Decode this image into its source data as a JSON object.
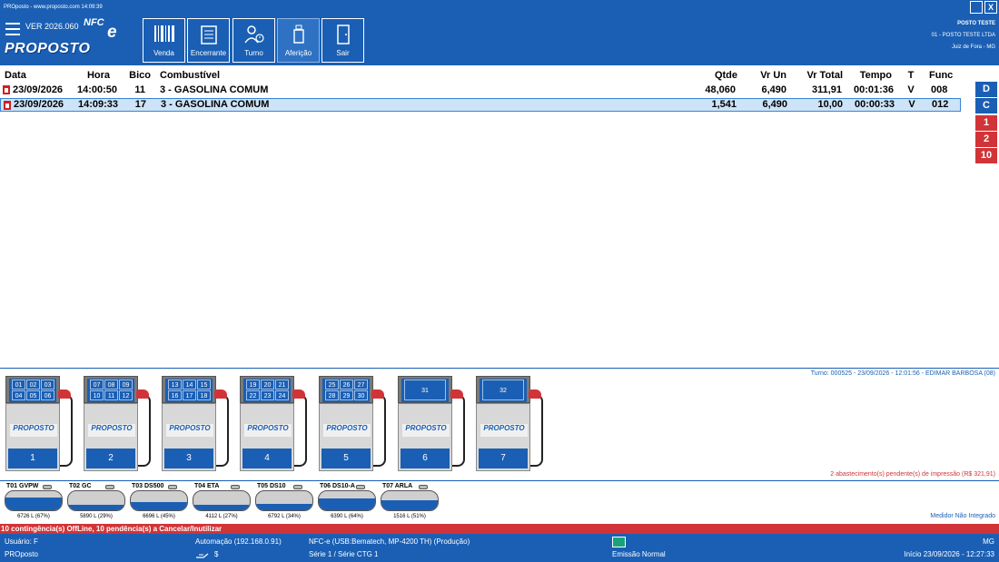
{
  "titlebar": {
    "text": "PROposto - www.proposto.com 14:09:39",
    "minimize_label": "",
    "close_label": "X"
  },
  "header": {
    "version": "VER 2026.060",
    "nfce_text": "NFC",
    "nfce_e": "e",
    "brand_text": "PROPOSTO",
    "buttons": [
      {
        "label": "Venda",
        "icon": "barcode-icon"
      },
      {
        "label": "Encerrante",
        "icon": "clipboard-icon"
      },
      {
        "label": "Turno",
        "icon": "person-clock-icon"
      },
      {
        "label": "Aferição",
        "icon": "flask-icon"
      },
      {
        "label": "Sair",
        "icon": "door-icon"
      }
    ],
    "posto": {
      "name": "POSTO TESTE",
      "company": "01 - POSTO TESTE LTDA",
      "city": "Juiz de Fora - MG"
    }
  },
  "grid": {
    "columns": [
      "Data",
      "Hora",
      "Bico",
      "Combustível",
      "Qtde",
      "Vr Un",
      "Vr Total",
      "Tempo",
      "T",
      "Func"
    ],
    "rows": [
      {
        "data": "23/09/2026",
        "hora": "14:00:50",
        "bico": "11",
        "combustivel": "3 - GASOLINA COMUM",
        "qtde": "48,060",
        "vrun": "6,490",
        "vrtotal": "311,91",
        "tempo": "00:01:36",
        "t": "V",
        "func": "008"
      },
      {
        "data": "23/09/2026",
        "hora": "14:09:33",
        "bico": "17",
        "combustivel": "3 - GASOLINA COMUM",
        "qtde": "1,541",
        "vrun": "6,490",
        "vrtotal": "10,00",
        "tempo": "00:00:33",
        "t": "V",
        "func": "012"
      }
    ],
    "side_buttons": [
      {
        "label": "D",
        "color": "blue"
      },
      {
        "label": "C",
        "color": "blue"
      },
      {
        "label": "1",
        "color": "red"
      },
      {
        "label": "2",
        "color": "red"
      },
      {
        "label": "10",
        "color": "red"
      }
    ]
  },
  "turno_info": "Turno: 000525 - 23/09/2026 - 12:01:56 - EDIMAR BARBOSA (08)",
  "pumps": [
    {
      "number": "1",
      "nozzles": [
        "01",
        "02",
        "03",
        "04",
        "05",
        "06"
      ]
    },
    {
      "number": "2",
      "nozzles": [
        "07",
        "08",
        "09",
        "10",
        "11",
        "12"
      ]
    },
    {
      "number": "3",
      "nozzles": [
        "13",
        "14",
        "15",
        "16",
        "17",
        "18"
      ]
    },
    {
      "number": "4",
      "nozzles": [
        "19",
        "20",
        "21",
        "22",
        "23",
        "24"
      ]
    },
    {
      "number": "5",
      "nozzles": [
        "25",
        "26",
        "27",
        "28",
        "29",
        "30"
      ]
    },
    {
      "number": "6",
      "nozzles": [
        "31"
      ]
    },
    {
      "number": "7",
      "nozzles": [
        "32"
      ]
    }
  ],
  "pump_logo": "PROPOSTO",
  "pending_info": "2 abastecimento(s) pendente(s) de impressão (R$ 321,91)",
  "tanks": [
    {
      "label": "T01 GVPW",
      "volume": "6726 L (67%)",
      "fill": 0.67
    },
    {
      "label": "T02 GC",
      "volume": "5890 L (29%)",
      "fill": 0.29
    },
    {
      "label": "T03 DS500",
      "volume": "6696 L (45%)",
      "fill": 0.45
    },
    {
      "label": "T04 ETA",
      "volume": "4112 L (27%)",
      "fill": 0.27
    },
    {
      "label": "T05 DS10",
      "volume": "6792 L (34%)",
      "fill": 0.34
    },
    {
      "label": "T06 DS10-A",
      "volume": "6390 L (64%)",
      "fill": 0.64
    },
    {
      "label": "T07 ARLA",
      "volume": "1516 L (51%)",
      "fill": 0.51
    }
  ],
  "medidor_info": "Medidor Não Integrado",
  "contingency": "10 contingência(s) OffLine, 10 pendência(s) a Cancelar/Inutilizar",
  "statusbar": {
    "usuario": "Usuário: F",
    "app": "PROposto",
    "automacao": "Automação (192.168.0.91)",
    "money_symbol": "$",
    "nfce": "NFC-e (USB:Bematech, MP-4200 TH) (Produção)",
    "serie": "Série    1  /   Série CTG     1",
    "emissao": "Emissão Normal",
    "uf": "MG",
    "inicio": "Início 23/09/2026 - 12:27:33"
  },
  "colors": {
    "brand_blue": "#1a5fb4",
    "alert_red": "#d13438",
    "selected_row": "#cde3f7"
  }
}
